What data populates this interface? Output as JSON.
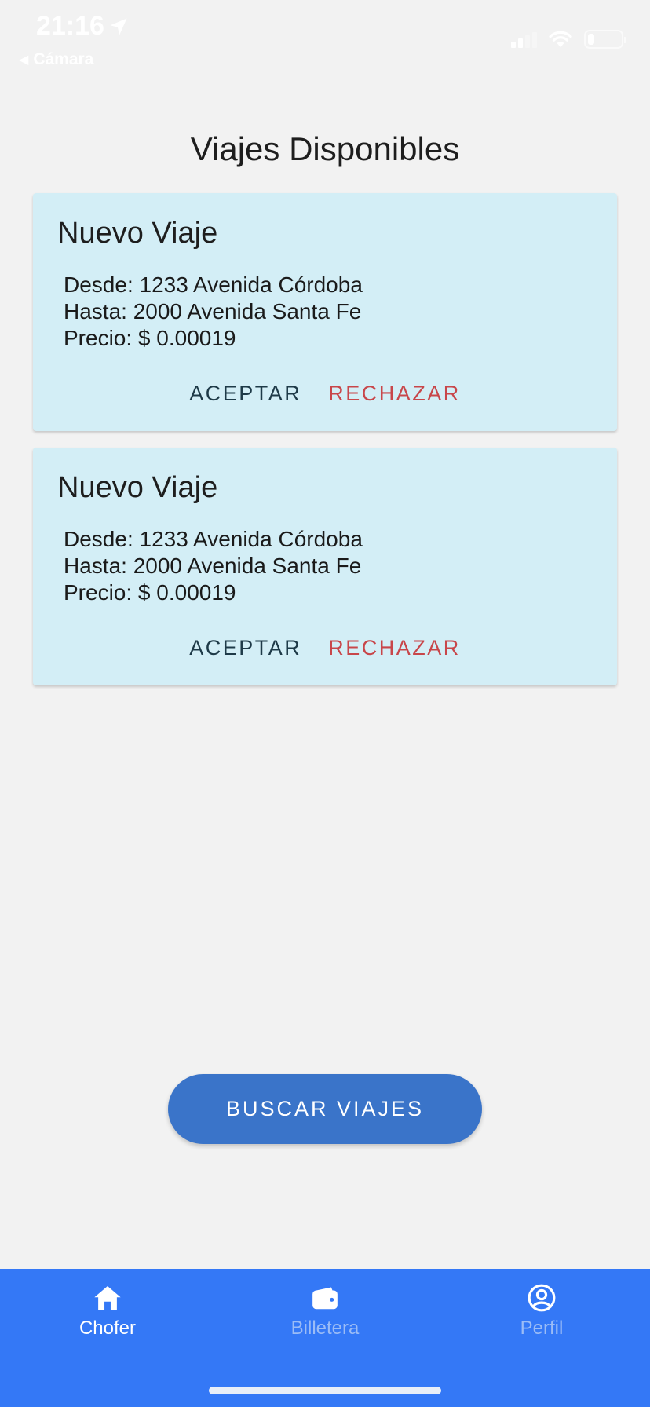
{
  "status_bar": {
    "time": "21:16",
    "back_app": "Cámara",
    "battery_level": 0.2
  },
  "page": {
    "title": "Viajes Disponibles"
  },
  "trips": [
    {
      "title": "Nuevo Viaje",
      "from": "Desde: 1233 Avenida Córdoba",
      "to": "Hasta: 2000 Avenida Santa Fe",
      "price": "Precio: $ 0.00019",
      "accept_label": "ACEPTAR",
      "reject_label": "RECHAZAR"
    },
    {
      "title": "Nuevo Viaje",
      "from": "Desde: 1233 Avenida Córdoba",
      "to": "Hasta: 2000 Avenida Santa Fe",
      "price": "Precio: $ 0.00019",
      "accept_label": "ACEPTAR",
      "reject_label": "RECHAZAR"
    }
  ],
  "search_button": {
    "label": "BUSCAR VIAJES"
  },
  "bottom_nav": {
    "items": [
      {
        "label": "Chofer",
        "icon": "home-icon",
        "active": true
      },
      {
        "label": "Billetera",
        "icon": "wallet-icon",
        "active": false
      },
      {
        "label": "Perfil",
        "icon": "user-circle-icon",
        "active": false
      }
    ]
  },
  "colors": {
    "background": "#f2f2f2",
    "card": "#d3eef6",
    "accept": "#1e3a48",
    "reject": "#c8464a",
    "primary_button": "#3a74c9",
    "nav_bar": "#3478f6"
  }
}
